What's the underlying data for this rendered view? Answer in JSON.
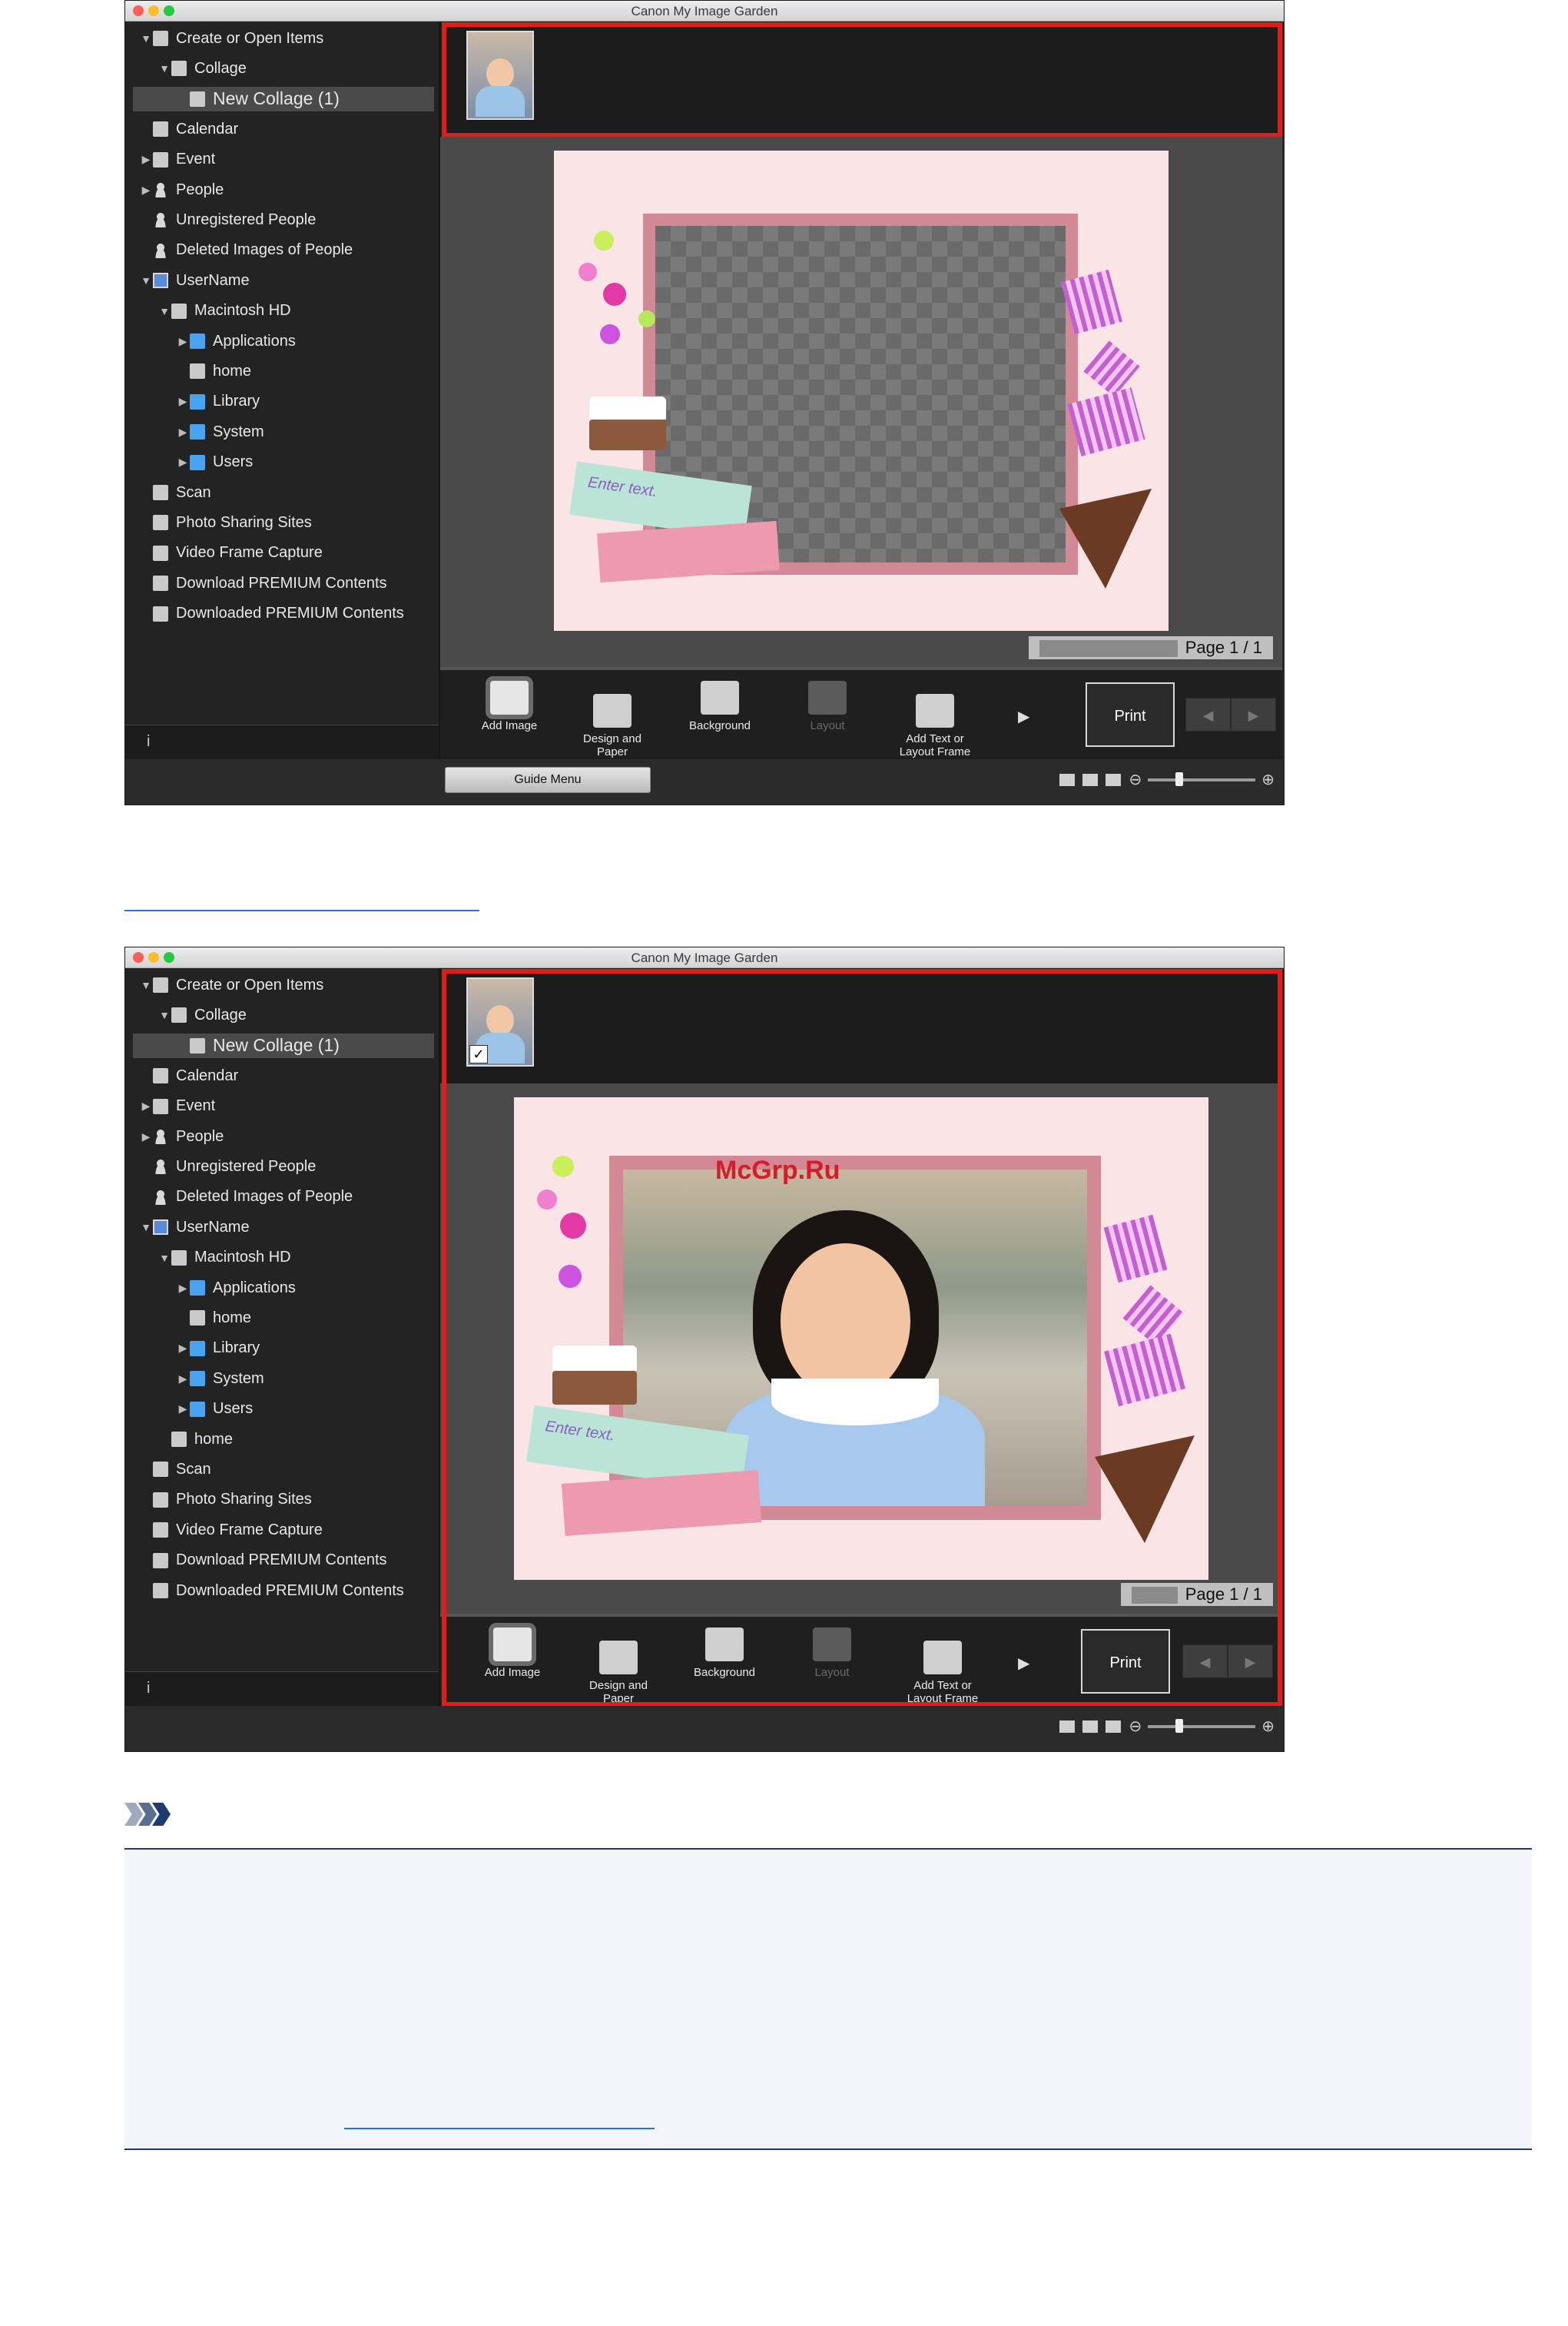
{
  "screens": [
    {
      "window_title": "Canon My Image Garden",
      "tree": [
        {
          "label": "Create or Open Items",
          "indent": 0,
          "arrow": "▼",
          "icon": "create-icon"
        },
        {
          "label": "Collage",
          "indent": 1,
          "arrow": "▼",
          "icon": "collage-icon"
        },
        {
          "label": "New Collage (1)",
          "indent": 2,
          "arrow": "",
          "icon": "collage-item-icon",
          "selected": true
        },
        {
          "label": "Calendar",
          "indent": 0,
          "arrow": "",
          "icon": "calendar-icon"
        },
        {
          "label": "Event",
          "indent": 0,
          "arrow": "▶",
          "icon": "event-icon"
        },
        {
          "label": "People",
          "indent": 0,
          "arrow": "▶",
          "icon": "people-icon"
        },
        {
          "label": "Unregistered People",
          "indent": 0,
          "arrow": "",
          "icon": "unregistered-people-icon"
        },
        {
          "label": "Deleted Images of People",
          "indent": 0,
          "arrow": "",
          "icon": "deleted-people-icon"
        },
        {
          "label": "UserName",
          "indent": 0,
          "arrow": "▼",
          "icon": "computer-icon"
        },
        {
          "label": "Macintosh HD",
          "indent": 1,
          "arrow": "▼",
          "icon": "disk-icon"
        },
        {
          "label": "Applications",
          "indent": 2,
          "arrow": "▶",
          "icon": "folder-icon"
        },
        {
          "label": "home",
          "indent": 2,
          "arrow": "",
          "icon": "disk-icon"
        },
        {
          "label": "Library",
          "indent": 2,
          "arrow": "▶",
          "icon": "folder-icon"
        },
        {
          "label": "System",
          "indent": 2,
          "arrow": "▶",
          "icon": "folder-icon"
        },
        {
          "label": "Users",
          "indent": 2,
          "arrow": "▶",
          "icon": "folder-icon"
        },
        {
          "label": "Scan",
          "indent": 0,
          "arrow": "",
          "icon": "scan-icon"
        },
        {
          "label": "Photo Sharing Sites",
          "indent": 0,
          "arrow": "",
          "icon": "photo-sharing-icon"
        },
        {
          "label": "Video Frame Capture",
          "indent": 0,
          "arrow": "",
          "icon": "video-icon"
        },
        {
          "label": "Download PREMIUM Contents",
          "indent": 0,
          "arrow": "",
          "icon": "download-icon"
        },
        {
          "label": "Downloaded PREMIUM Contents",
          "indent": 0,
          "arrow": "",
          "icon": "downloaded-icon"
        }
      ],
      "placeholder_text": [
        "Enter text."
      ],
      "page_indicator": "Page 1 / 1",
      "toolbar": [
        "Add Image",
        "Design and\nPaper",
        "Background",
        "Layout",
        "Add Text or\nLayout Frame"
      ],
      "print_label": "Print",
      "guide_menu": "Guide Menu",
      "photo_placed": false
    },
    {
      "window_title": "Canon My Image Garden",
      "tree": [
        {
          "label": "Create or Open Items",
          "indent": 0,
          "arrow": "▼",
          "icon": "create-icon"
        },
        {
          "label": "Collage",
          "indent": 1,
          "arrow": "▼",
          "icon": "collage-icon"
        },
        {
          "label": "New Collage (1)",
          "indent": 2,
          "arrow": "",
          "icon": "collage-item-icon",
          "selected": true
        },
        {
          "label": "Calendar",
          "indent": 0,
          "arrow": "",
          "icon": "calendar-icon"
        },
        {
          "label": "Event",
          "indent": 0,
          "arrow": "▶",
          "icon": "event-icon"
        },
        {
          "label": "People",
          "indent": 0,
          "arrow": "▶",
          "icon": "people-icon"
        },
        {
          "label": "Unregistered People",
          "indent": 0,
          "arrow": "",
          "icon": "unregistered-people-icon"
        },
        {
          "label": "Deleted Images of People",
          "indent": 0,
          "arrow": "",
          "icon": "deleted-people-icon"
        },
        {
          "label": "UserName",
          "indent": 0,
          "arrow": "▼",
          "icon": "computer-icon"
        },
        {
          "label": "Macintosh HD",
          "indent": 1,
          "arrow": "▼",
          "icon": "disk-icon"
        },
        {
          "label": "Applications",
          "indent": 2,
          "arrow": "▶",
          "icon": "folder-icon"
        },
        {
          "label": "home",
          "indent": 2,
          "arrow": "",
          "icon": "disk-icon"
        },
        {
          "label": "Library",
          "indent": 2,
          "arrow": "▶",
          "icon": "folder-icon"
        },
        {
          "label": "System",
          "indent": 2,
          "arrow": "▶",
          "icon": "folder-icon"
        },
        {
          "label": "Users",
          "indent": 2,
          "arrow": "▶",
          "icon": "folder-icon"
        },
        {
          "label": "home",
          "indent": 1,
          "arrow": "",
          "icon": "disk-icon"
        },
        {
          "label": "Scan",
          "indent": 0,
          "arrow": "",
          "icon": "scan-icon"
        },
        {
          "label": "Photo Sharing Sites",
          "indent": 0,
          "arrow": "",
          "icon": "photo-sharing-icon"
        },
        {
          "label": "Video Frame Capture",
          "indent": 0,
          "arrow": "",
          "icon": "video-icon"
        },
        {
          "label": "Download PREMIUM Contents",
          "indent": 0,
          "arrow": "",
          "icon": "download-icon"
        },
        {
          "label": "Downloaded PREMIUM Contents",
          "indent": 0,
          "arrow": "",
          "icon": "downloaded-icon"
        }
      ],
      "placeholder_text": [
        "Enter text."
      ],
      "watermark": "McGrp.Ru",
      "page_indicator": "Page 1 / 1",
      "toolbar": [
        "Add Image",
        "Design and\nPaper",
        "Background",
        "Layout",
        "Add Text or\nLayout Frame"
      ],
      "print_label": "Print",
      "photo_placed": true
    }
  ],
  "colors": {
    "highlight_frame": "#e31b1b",
    "page_background": "#fbe4e6",
    "photo_frame": "#d38995",
    "note_border": "#1f3a70"
  }
}
